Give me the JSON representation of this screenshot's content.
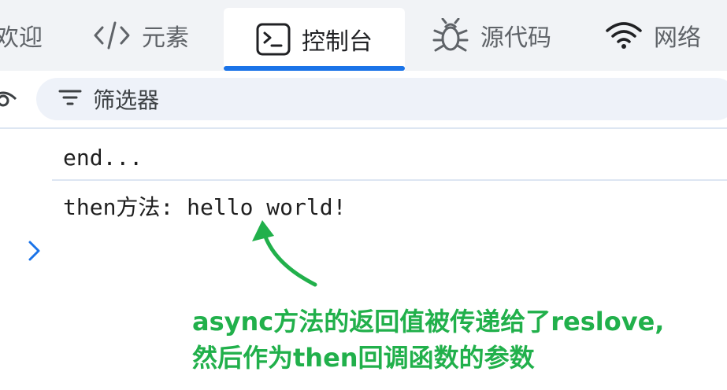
{
  "tabs": [
    {
      "label": "欢迎",
      "icon": "welcome-icon",
      "active": false
    },
    {
      "label": "元素",
      "icon": "code-brackets-icon",
      "active": false
    },
    {
      "label": "控制台",
      "icon": "terminal-icon",
      "active": true
    },
    {
      "label": "源代码",
      "icon": "bug-icon",
      "active": false
    },
    {
      "label": "网络",
      "icon": "wifi-icon",
      "active": false
    }
  ],
  "filter": {
    "label": "筛选器",
    "icon": "filter-icon"
  },
  "console": {
    "lines": [
      "end...",
      "then方法: hello world!"
    ],
    "prompt_icon": "chevron-right-icon"
  },
  "annotation": {
    "line1": "async方法的返回值被传递给了reslove,",
    "line2": "然后作为then回调函数的参数",
    "color": "#21b04b"
  },
  "colors": {
    "accent": "#1a73e8",
    "annotation": "#21b04b"
  }
}
